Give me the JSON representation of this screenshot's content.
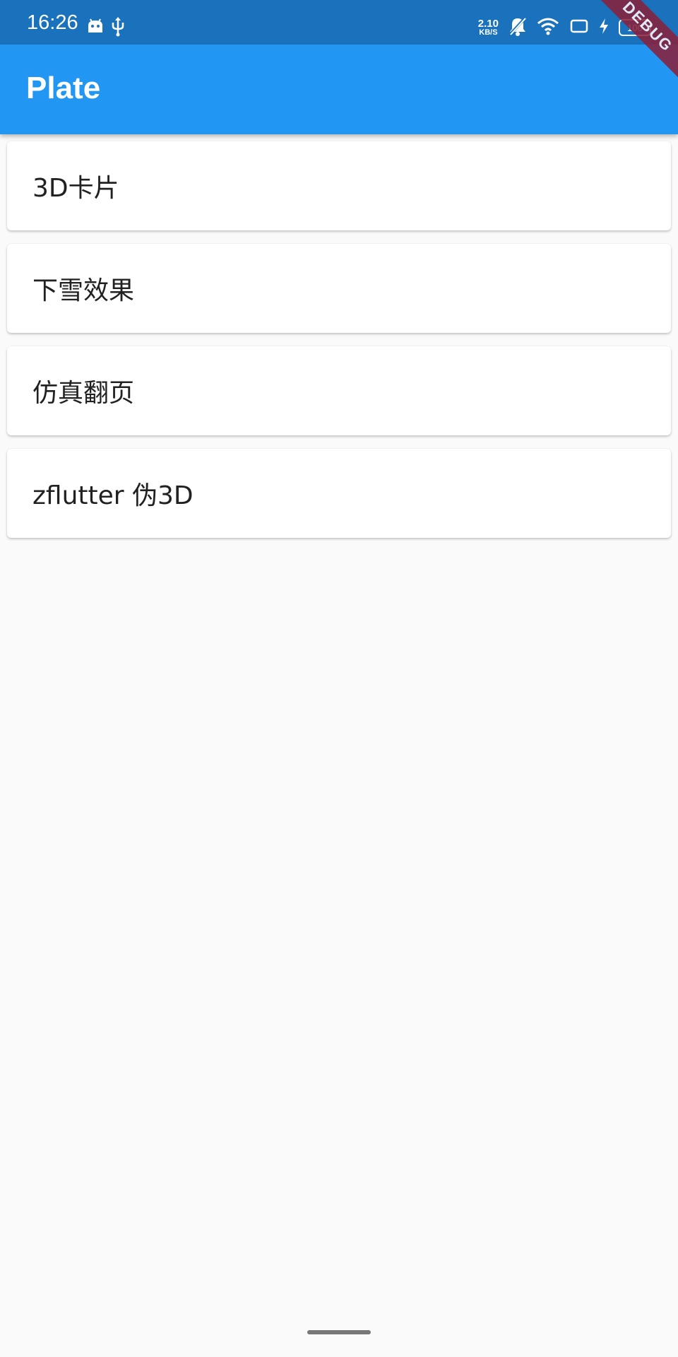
{
  "status_bar": {
    "time": "16:26",
    "net_speed": "2.10",
    "net_unit": "KB/S",
    "battery": "100"
  },
  "app_bar": {
    "title": "Plate"
  },
  "debug_banner": "DEBUG",
  "list": {
    "items": [
      {
        "label": "3D卡片"
      },
      {
        "label": "下雪效果"
      },
      {
        "label": "仿真翻页"
      },
      {
        "label": "zflutter 伪3D"
      }
    ]
  },
  "colors": {
    "status_bar": "#1a72bd",
    "app_bar": "#2196f3",
    "background": "#fafafa",
    "card": "#ffffff",
    "debug_banner": "#8b1f38"
  },
  "icons": {
    "status_left": [
      "android-icon",
      "usb-icon"
    ],
    "status_right": [
      "bell-off-icon",
      "wifi-icon",
      "screen-rotate-icon",
      "charging-icon"
    ]
  }
}
